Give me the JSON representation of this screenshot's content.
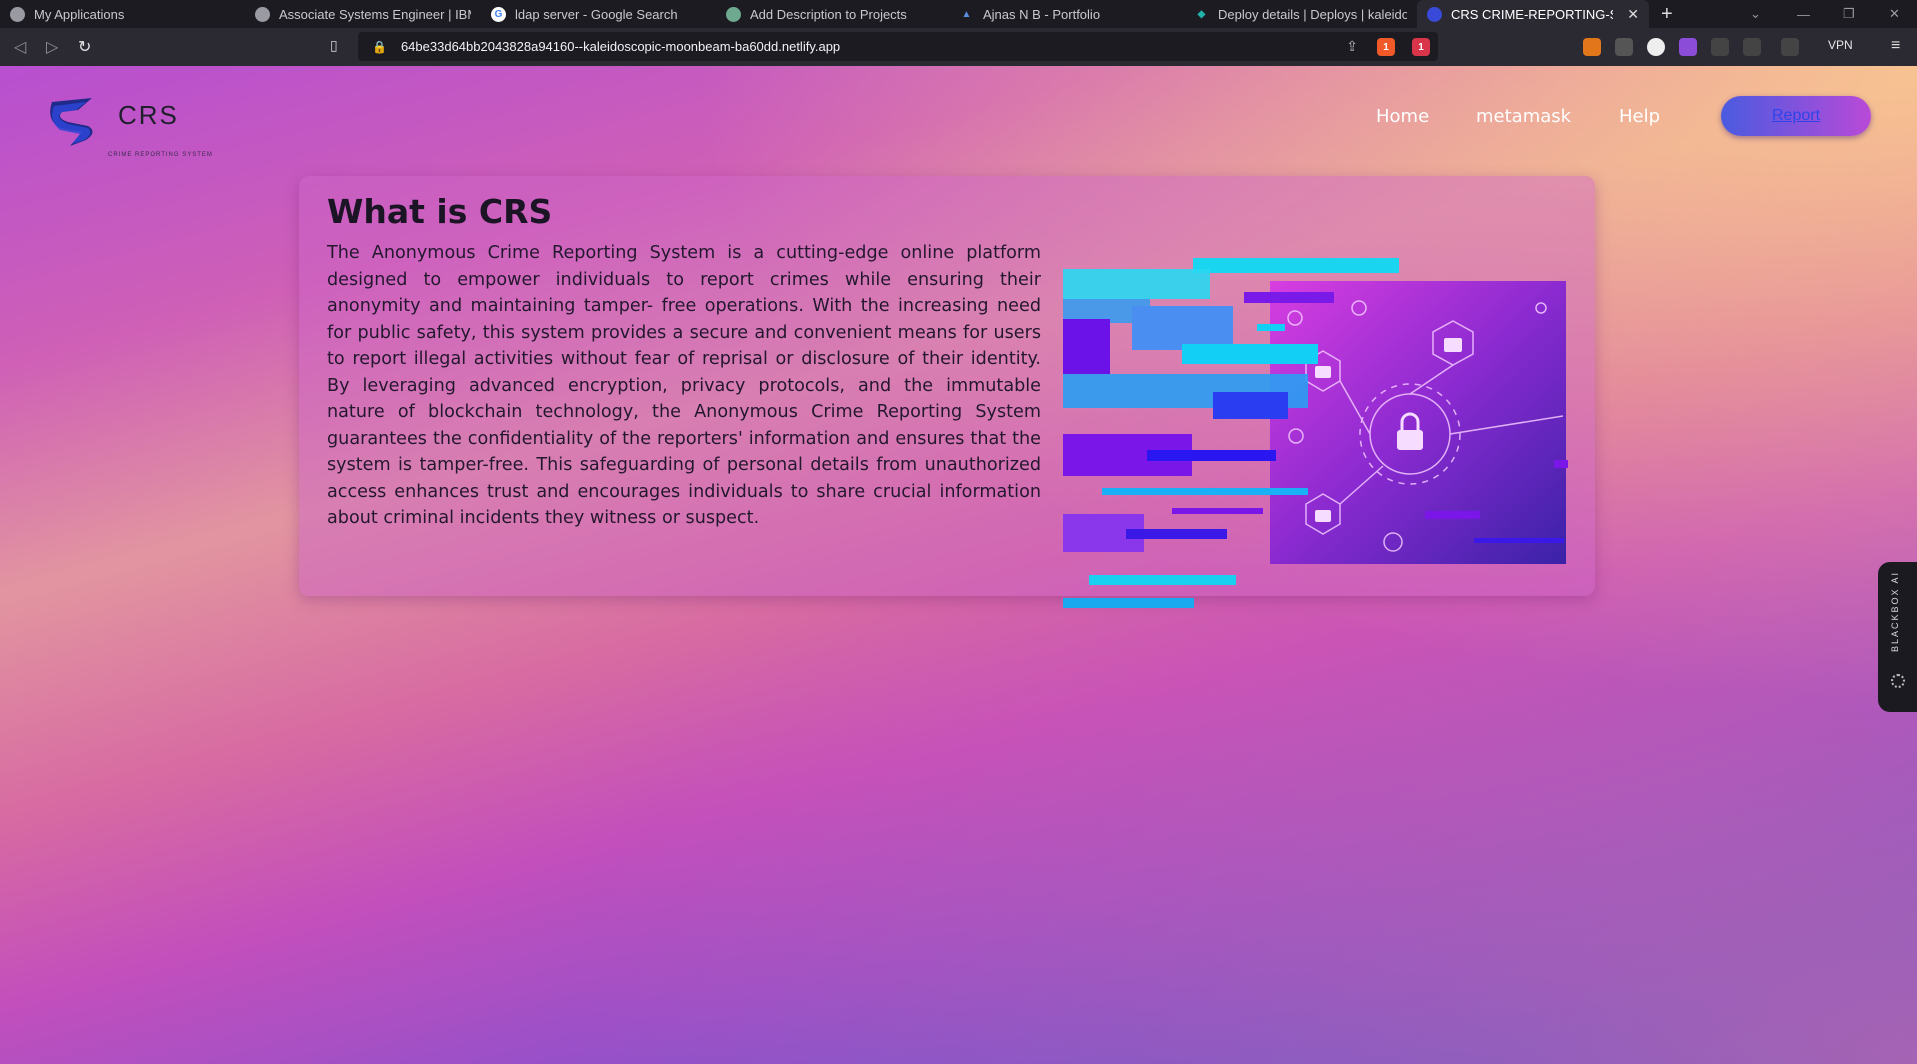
{
  "browser": {
    "tabs": [
      {
        "title": "My Applications",
        "icon": "globe-icon",
        "color": "#9a9aa2"
      },
      {
        "title": "Associate Systems Engineer | IBM Car",
        "icon": "globe-icon",
        "color": "#9a9aa2"
      },
      {
        "title": "ldap server - Google Search",
        "icon": "google-icon",
        "color": "#ffffff"
      },
      {
        "title": "Add Description to Projects",
        "icon": "chatgpt-icon",
        "color": "#6ea88f"
      },
      {
        "title": "Ajnas N B - Portfolio",
        "icon": "portfolio-icon",
        "color": "#5a8ce0"
      },
      {
        "title": "Deploy details | Deploys | kaleidoscop",
        "icon": "netlify-icon",
        "color": "#20b2a8"
      },
      {
        "title": "CRS CRIME-REPORTING-SYSTEM",
        "icon": "crs-logo-icon",
        "color": "#3a4ad8",
        "active": true
      }
    ],
    "url": "64be33d64bb2043828a94160--kaleidoscopic-moonbeam-ba60dd.netlify.app",
    "vpn_label": "VPN",
    "shield_badge": "1",
    "alert_badge": "1"
  },
  "site": {
    "logo_text": "CRS",
    "logo_sub": "CRIME REPORTING SYSTEM",
    "nav": {
      "home": "Home",
      "metamask": "metamask",
      "help": "Help",
      "report": "Report"
    },
    "about": {
      "title": "What is CRS",
      "body": "The Anonymous Crime Reporting System is a cutting-edge online platform designed to empower individuals to report crimes while ensuring their anonymity and maintaining tamper- free operations. With the increasing need for public safety, this system provides a secure and convenient means for users to report illegal activities without fear of reprisal or disclosure of their identity. By leveraging advanced encryption, privacy protocols, and the immutable nature of blockchain technology, the Anonymous Crime Reporting System guarantees the confidentiality of the reporters' information and ensures that the system is tamper-free. This safeguarding of personal details from unauthorized access enhances trust and encourages individuals to share crucial information about criminal incidents they witness or suspect."
    },
    "side_widget": "BLACKBOX AI"
  },
  "colors": {
    "accent_blue": "#2f44e8",
    "page_gradient_top": "#b74fd0",
    "page_gradient_bottom": "#4a56d6"
  }
}
